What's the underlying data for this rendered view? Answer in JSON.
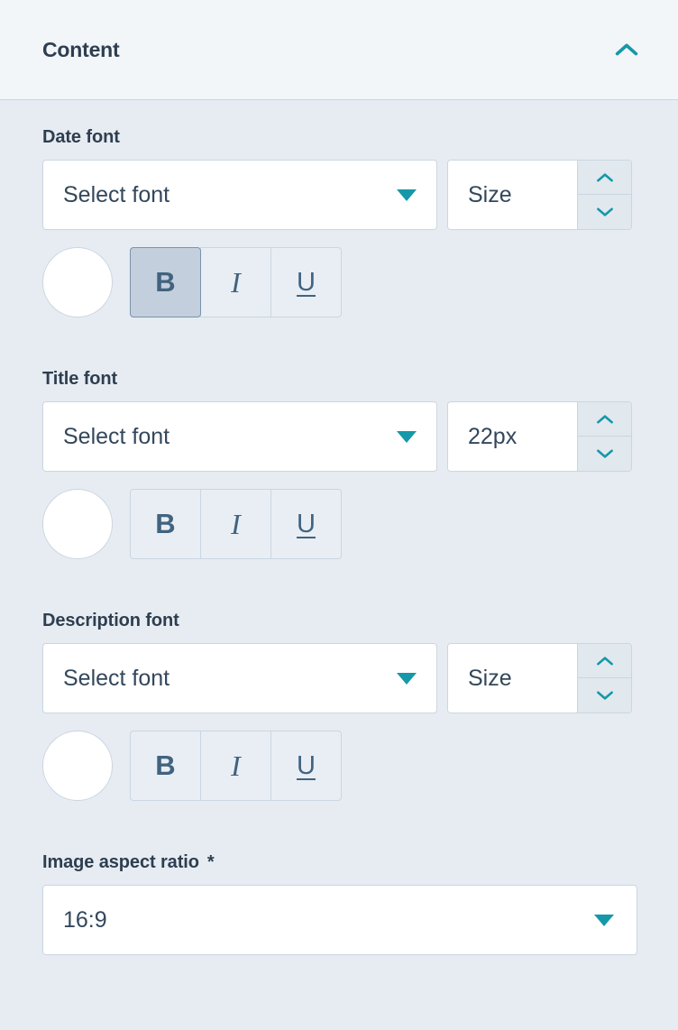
{
  "panel": {
    "title": "Content",
    "collapse_icon": "chevron-up-icon",
    "accent_color": "#1598a8",
    "label_color": "#2e3e50",
    "header_bg": "#f2f6f9",
    "body_bg": "#e6ecf2",
    "border_color": "#cbd6e2"
  },
  "fields": {
    "date_font": {
      "label": "Date font",
      "font_select_value": "Select font",
      "size_placeholder": "Size",
      "size_value": "",
      "color_swatch": "#ffffff",
      "bold_label": "B",
      "italic_label": "I",
      "underline_label": "U",
      "bold_active": true,
      "italic_active": false,
      "underline_active": false
    },
    "title_font": {
      "label": "Title font",
      "font_select_value": "Select font",
      "size_placeholder": "Size",
      "size_value": "22px",
      "color_swatch": "#ffffff",
      "bold_label": "B",
      "italic_label": "I",
      "underline_label": "U",
      "bold_active": false,
      "italic_active": false,
      "underline_active": false
    },
    "description_font": {
      "label": "Description font",
      "font_select_value": "Select font",
      "size_placeholder": "Size",
      "size_value": "",
      "color_swatch": "#ffffff",
      "bold_label": "B",
      "italic_label": "I",
      "underline_label": "U",
      "bold_active": false,
      "italic_active": false,
      "underline_active": false
    },
    "image_aspect_ratio": {
      "label": "Image aspect ratio",
      "required_marker": "*",
      "value": "16:9"
    }
  }
}
